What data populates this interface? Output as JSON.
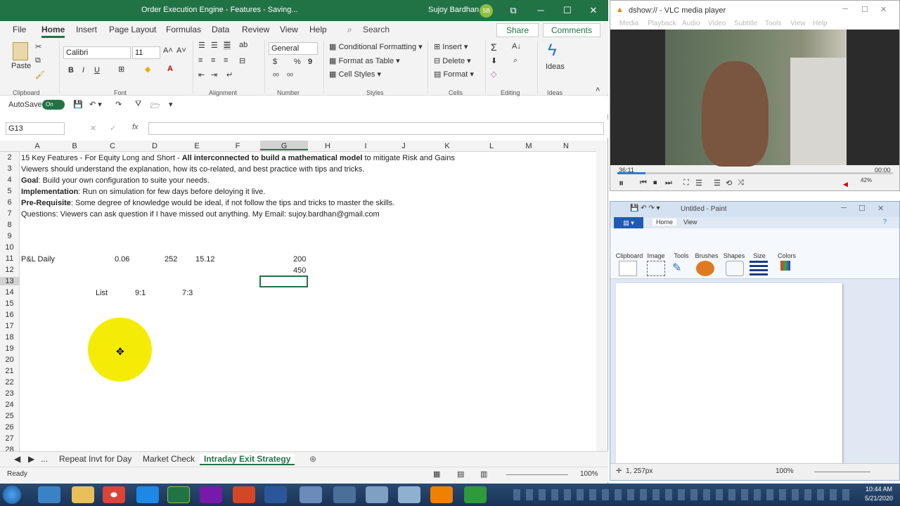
{
  "excel": {
    "title": "Order Execution Engine - Features - Saving...",
    "user": "Sujoy Bardhan",
    "avatar": "SB",
    "window_buttons": [
      "⧉",
      "─",
      "☐",
      "✕"
    ],
    "ribbon_tabs": [
      "File",
      "Home",
      "Insert",
      "Page Layout",
      "Formulas",
      "Data",
      "Review",
      "View",
      "Help"
    ],
    "search": "Search",
    "share": "Share",
    "comments": "Comments",
    "clipboard": {
      "paste": "Paste",
      "label": "Clipboard"
    },
    "font": {
      "name": "Calibri",
      "size": "11",
      "bold": "B",
      "italic": "I",
      "underline": "U",
      "label": "Font"
    },
    "alignment": {
      "label": "Alignment"
    },
    "number": {
      "format": "General",
      "currency": "$",
      "percent": "%",
      "comma": "9",
      "label": "Number"
    },
    "styles": {
      "conditional": "Conditional Formatting",
      "table": "Format as Table",
      "cell": "Cell Styles",
      "label": "Styles"
    },
    "cells": {
      "insert": "Insert",
      "delete": "Delete",
      "format": "Format",
      "label": "Cells"
    },
    "editing": {
      "sum": "Σ",
      "label": "Editing"
    },
    "ideas": {
      "button": "Ideas",
      "label": "Ideas"
    },
    "autosave": "AutoSave",
    "autosave_state": "On",
    "name_box": "G13",
    "formula_icon": "fx",
    "columns": [
      "A",
      "B",
      "C",
      "D",
      "E",
      "F",
      "G",
      "H",
      "I",
      "J",
      "K",
      "L",
      "M",
      "N"
    ],
    "rows": [
      "2",
      "3",
      "4",
      "5",
      "6",
      "7",
      "8",
      "9",
      "10",
      "11",
      "12",
      "13",
      "14",
      "15",
      "16",
      "17",
      "18",
      "19",
      "20",
      "21",
      "22",
      "23",
      "24",
      "25",
      "26",
      "27",
      "28"
    ],
    "cells_text": {
      "r2a": "15 Key Features - For Equity Long and Short - ",
      "r2b": "All interconnected to build a mathematical model",
      "r2c": " to mitigate Risk and Gains",
      "r3": "Viewers should understand the explanation, how its co-related, and best practice with tips and tricks.",
      "r4a": "Goal",
      "r4b": ": Build your own configuration to suite your needs.",
      "r5a": "Implementation",
      "r5b": ": Run on simulation for few days before deloying it live.",
      "r6a": "Pre-Requisite",
      "r6b": ": Some degree of knowledge would be ideal, if not follow the tips and tricks to master the skills.",
      "r7": "Questions: Viewers can ask question if I have missed out anything. My Email: sujoy.bardhan@gmail.com",
      "a11": "P&L Daily",
      "c11": "0.06",
      "d11": "252",
      "e11": "15.12",
      "g11": "200",
      "g12": "450",
      "b14": "List",
      "c14": "9:1",
      "e14": "7:3"
    },
    "sheet_tabs": [
      "...",
      "Repeat Invt for Day",
      "Market Check",
      "Intraday Exit Strategy"
    ],
    "status": "Ready",
    "zoom": "100%"
  },
  "vlc": {
    "title": "dshow:// - VLC media player",
    "menu": [
      "Media",
      "Playback",
      "Audio",
      "Video",
      "Subtitle",
      "Tools",
      "View",
      "Help"
    ],
    "time_elapsed": "36:11",
    "time_total": "00:00",
    "volume": "42%"
  },
  "paint": {
    "title": "Untitled - Paint",
    "tabs": [
      "Home",
      "View"
    ],
    "groups": [
      "Clipboard",
      "Image",
      "Tools",
      "Brushes",
      "Shapes",
      "Size",
      "Colors"
    ],
    "coords": "1, 257px",
    "zoom": "100%"
  },
  "taskbar": {
    "time": "10:44 AM",
    "date": "5/21/2020"
  }
}
